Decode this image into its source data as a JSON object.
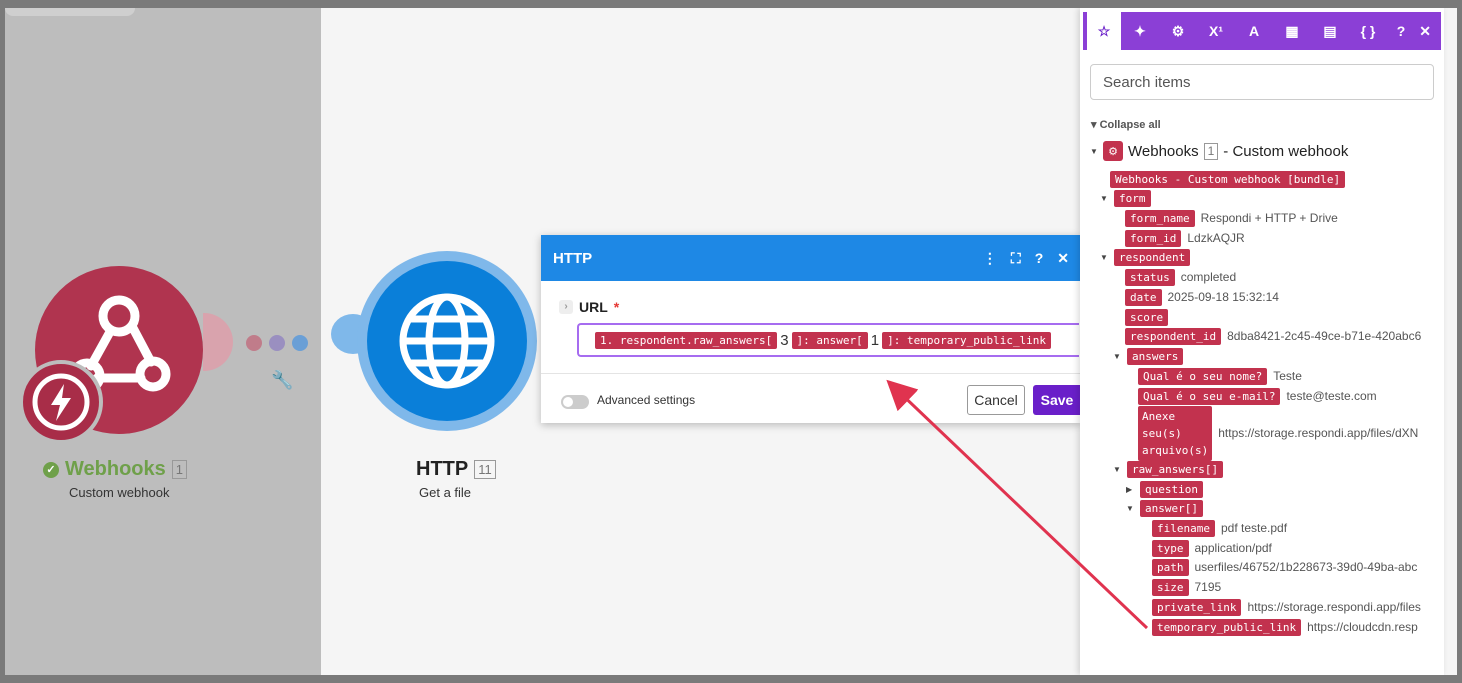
{
  "modules": {
    "webhooks": {
      "title": "Webhooks",
      "num": "1",
      "subtitle": "Custom webhook"
    },
    "http": {
      "title": "HTTP",
      "num": "11",
      "subtitle": "Get a file"
    }
  },
  "dialog": {
    "title": "HTTP",
    "tools": [
      "⋮",
      "⛶",
      "?",
      "✕"
    ],
    "url_label": "URL",
    "required_mark": "*",
    "url_tokens": [
      {
        "type": "pill",
        "text": "1. respondent.raw_answers["
      },
      {
        "type": "text",
        "text": "3"
      },
      {
        "type": "pill",
        "text": "]: answer["
      },
      {
        "type": "text",
        "text": "1"
      },
      {
        "type": "pill",
        "text": "]: temporary_public_link"
      }
    ],
    "advanced_settings": "Advanced settings",
    "cancel": "Cancel",
    "save": "Save"
  },
  "panel": {
    "tabs": [
      "☆",
      "✦",
      "⚙",
      "X¹",
      "A",
      "▦",
      "▤",
      "{ }"
    ],
    "help": "?",
    "close": "✕",
    "search_placeholder": "Search items",
    "collapse_all": "Collapse all",
    "tree_title": "Webhooks",
    "tree_num": "1",
    "tree_subtitle": "- Custom webhook",
    "bundle_label": "Webhooks - Custom webhook [bundle]",
    "items": {
      "form": "form",
      "form_name": {
        "key": "form_name",
        "value": "Respondi + HTTP + Drive"
      },
      "form_id": {
        "key": "form_id",
        "value": "LdzkAQJR"
      },
      "respondent": "respondent",
      "status": {
        "key": "status",
        "value": "completed"
      },
      "date": {
        "key": "date",
        "value": "2025-09-18 15:32:14"
      },
      "score": {
        "key": "score",
        "value": ""
      },
      "respondent_id": {
        "key": "respondent_id",
        "value": "8dba8421-2c45-49ce-b71e-420abc6"
      },
      "answers": "answers",
      "q_nome": {
        "key": "Qual é o seu nome?",
        "value": "Teste"
      },
      "q_email": {
        "key": "Qual é o seu e-mail?",
        "value": "teste@teste.com"
      },
      "anexe_lines": [
        "Anexe",
        "seu(s)",
        "arquivo(s)"
      ],
      "anexe_value": "https://storage.respondi.app/files/dXN",
      "raw_answers": "raw_answers[]",
      "question": "question",
      "answer": "answer[]",
      "filename": {
        "key": "filename",
        "value": "pdf teste.pdf"
      },
      "type": {
        "key": "type",
        "value": "application/pdf"
      },
      "path": {
        "key": "path",
        "value": "userfiles/46752/1b228673-39d0-49ba-abc"
      },
      "size": {
        "key": "size",
        "value": "7195"
      },
      "private_link": {
        "key": "private_link",
        "value": "https://storage.respondi.app/files"
      },
      "temporary_public_link": {
        "key": "temporary_public_link",
        "value": "https://cloudcdn.resp"
      }
    }
  },
  "colors": {
    "accent_purple": "#8b3fd6",
    "pill_red": "#c2324e",
    "http_blue": "#0a7fd9",
    "webhook_red": "#b0344f",
    "success_green": "#6fa04a",
    "arrow": "#e0334f"
  }
}
